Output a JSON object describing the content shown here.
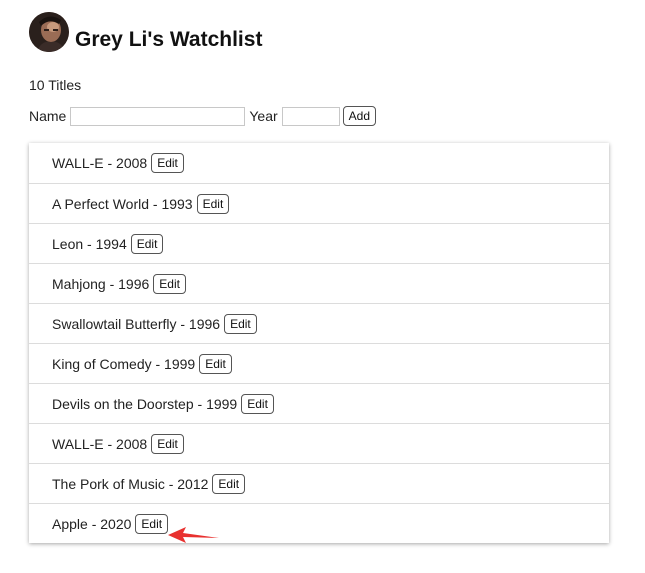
{
  "header": {
    "title": "Grey Li's Watchlist",
    "avatar_icon": "user-avatar"
  },
  "count_text": "10 Titles",
  "form": {
    "name_label": "Name",
    "name_value": "",
    "year_label": "Year",
    "year_value": "",
    "add_label": "Add"
  },
  "movies": [
    {
      "text": "WALL-E - 2008",
      "edit_label": "Edit"
    },
    {
      "text": "A Perfect World - 1993",
      "edit_label": "Edit"
    },
    {
      "text": "Leon - 1994",
      "edit_label": "Edit"
    },
    {
      "text": "Mahjong - 1996",
      "edit_label": "Edit"
    },
    {
      "text": "Swallowtail Butterfly - 1996",
      "edit_label": "Edit"
    },
    {
      "text": "King of Comedy - 1999",
      "edit_label": "Edit"
    },
    {
      "text": "Devils on the Doorstep - 1999",
      "edit_label": "Edit"
    },
    {
      "text": "WALL-E - 2008",
      "edit_label": "Edit"
    },
    {
      "text": "The Pork of Music - 2012",
      "edit_label": "Edit"
    },
    {
      "text": "Apple - 2020",
      "edit_label": "Edit"
    }
  ],
  "annotation": {
    "arrow_icon": "red-arrow-icon",
    "arrow_color": "#e8312f"
  }
}
